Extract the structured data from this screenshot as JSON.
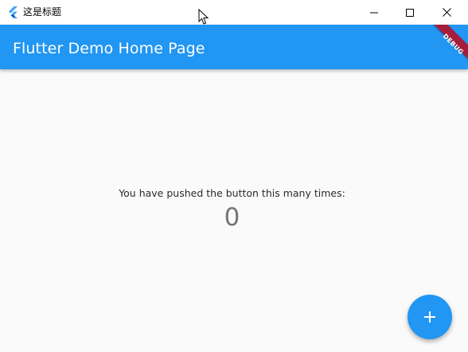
{
  "window": {
    "title": "这是标题",
    "controls": {
      "minimize_icon": "minimize-icon",
      "maximize_icon": "maximize-icon",
      "close_icon": "close-icon"
    }
  },
  "appbar": {
    "title": "Flutter Demo Home Page",
    "banner_label": "DEBUG",
    "color": "#2196f3",
    "banner_color": "#a41d3c"
  },
  "main": {
    "message": "You have pushed the button this many times:",
    "counter": "0"
  },
  "fab": {
    "icon": "plus-icon",
    "color": "#2196f3"
  }
}
